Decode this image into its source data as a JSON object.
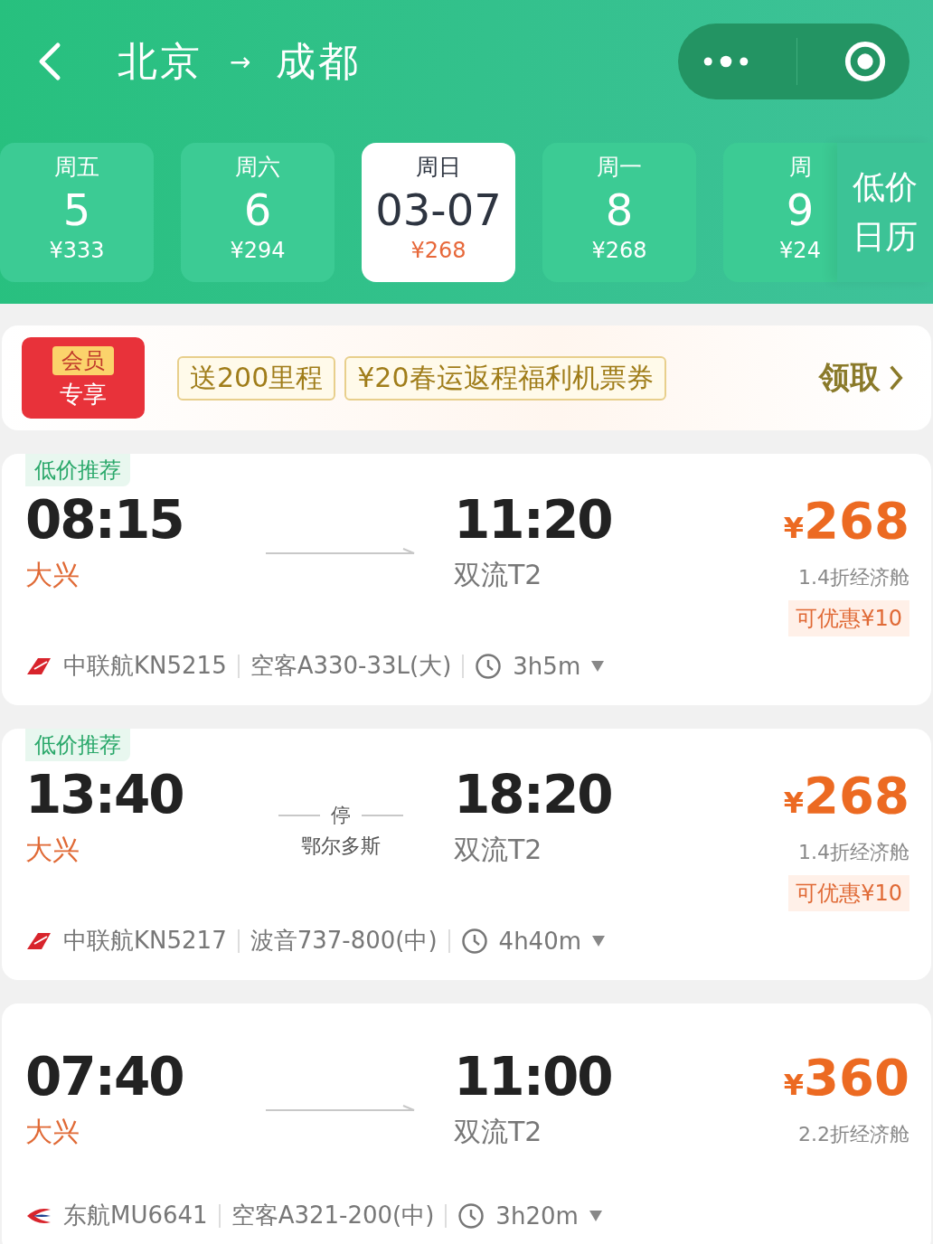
{
  "header": {
    "from": "北京",
    "arrow": "→",
    "to": "成都"
  },
  "date_tabs": [
    {
      "weekday": "周五",
      "day": "5",
      "price": "¥333",
      "selected": false
    },
    {
      "weekday": "周六",
      "day": "6",
      "price": "¥294",
      "selected": false
    },
    {
      "weekday": "周日",
      "day": "03-07",
      "price": "¥268",
      "selected": true
    },
    {
      "weekday": "周一",
      "day": "8",
      "price": "¥268",
      "selected": false
    },
    {
      "weekday": "周",
      "day": "9",
      "price": "¥24",
      "selected": false
    }
  ],
  "calendar_button": {
    "line1": "低价",
    "line2": "日历"
  },
  "promo": {
    "badge_top": "会员",
    "badge_bottom": "专享",
    "coupons": [
      "送200里程",
      "¥20春运返程福利机票券"
    ],
    "action": "领取"
  },
  "flights": [
    {
      "tag": "低价推荐",
      "depart_time": "08:15",
      "depart_airport": "大兴",
      "arrive_time": "11:20",
      "arrive_airport": "双流T2",
      "currency": "¥",
      "price": "268",
      "cabin": "1.4折经济舱",
      "discount": "可优惠¥10",
      "kind": "red-tail",
      "flight_no": "中联航KN5215",
      "aircraft": "空客A330-33L(大)",
      "duration": "3h5m"
    },
    {
      "tag": "低价推荐",
      "depart_time": "13:40",
      "depart_airport": "大兴",
      "arrive_time": "18:20",
      "arrive_airport": "双流T2",
      "stop": {
        "label": "停",
        "city": "鄂尔多斯"
      },
      "currency": "¥",
      "price": "268",
      "cabin": "1.4折经济舱",
      "discount": "可优惠¥10",
      "kind": "red-tail",
      "flight_no": "中联航KN5217",
      "aircraft": "波音737-800(中)",
      "duration": "4h40m"
    },
    {
      "depart_time": "07:40",
      "depart_airport": "大兴",
      "arrive_time": "11:00",
      "arrive_airport": "双流T2",
      "currency": "¥",
      "price": "360",
      "cabin": "2.2折经济舱",
      "kind": "swallow",
      "flight_no": "东航MU6641",
      "aircraft": "空客A321-200(中)",
      "duration": "3h20m"
    }
  ]
}
